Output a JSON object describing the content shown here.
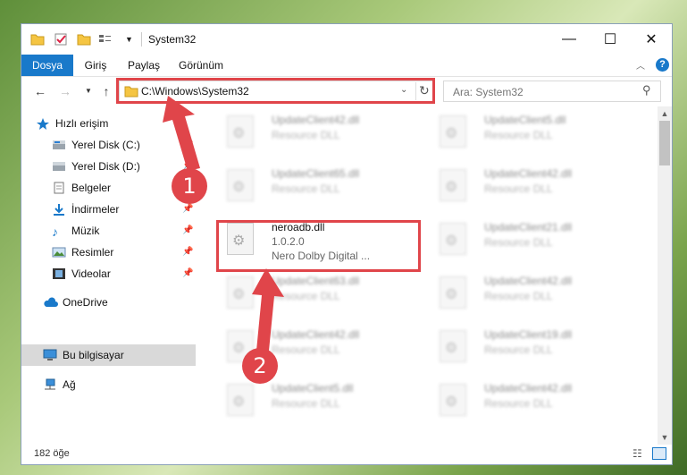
{
  "window": {
    "title": "System32",
    "controls": {
      "minimize": "—",
      "maximize": "☐",
      "close": "✕"
    }
  },
  "ribbon": {
    "tabs": [
      {
        "label": "Dosya",
        "active": true
      },
      {
        "label": "Giriş"
      },
      {
        "label": "Paylaş"
      },
      {
        "label": "Görünüm"
      }
    ],
    "help": "?"
  },
  "address": {
    "path": "C:\\Windows\\System32",
    "search_placeholder": "Ara: System32"
  },
  "sidebar": {
    "quick_access": "Hızlı erişim",
    "items": [
      {
        "label": "Yerel Disk (C:)",
        "icon": "drive-icon",
        "pinned": true
      },
      {
        "label": "Yerel Disk (D:)",
        "icon": "drive-icon",
        "pinned": true
      },
      {
        "label": "Belgeler",
        "icon": "documents-icon",
        "pinned": true
      },
      {
        "label": "İndirmeler",
        "icon": "download-icon",
        "pinned": true
      },
      {
        "label": "Müzik",
        "icon": "music-icon",
        "pinned": true
      },
      {
        "label": "Resimler",
        "icon": "pictures-icon",
        "pinned": true
      },
      {
        "label": "Videolar",
        "icon": "video-icon",
        "pinned": true
      }
    ],
    "onedrive": "OneDrive",
    "this_pc": "Bu bilgisayar",
    "network": "Ağ"
  },
  "files": {
    "left": [
      {
        "name": "UpdateClient42.dll",
        "desc": "Resource DLL"
      },
      {
        "name": "UpdateClient65.dll",
        "desc": "Resource DLL"
      },
      {
        "name": "neroadb.dll",
        "desc": "1.0.2.0",
        "desc2": "Nero Dolby Digital ...",
        "selected": true
      },
      {
        "name": "UpdateClient63.dll",
        "desc": "Resource DLL"
      },
      {
        "name": "UpdateClient42.dll",
        "desc": "Resource DLL"
      },
      {
        "name": "UpdateClient5.dll",
        "desc": "Resource DLL"
      }
    ],
    "right": [
      {
        "name": "UpdateClient5.dll",
        "desc": "Resource DLL"
      },
      {
        "name": "UpdateClient42.dll",
        "desc": "Resource DLL"
      },
      {
        "name": "UpdateClient21.dll",
        "desc": "Resource DLL"
      },
      {
        "name": "UpdateClient42.dll",
        "desc": "Resource DLL"
      },
      {
        "name": "UpdateClient19.dll",
        "desc": "Resource DLL"
      },
      {
        "name": "UpdateClient42.dll",
        "desc": "Resource DLL"
      }
    ]
  },
  "status": {
    "count": "182 öğe"
  },
  "annotations": {
    "step1": "1",
    "step2": "2",
    "accent": "#e0454a"
  }
}
